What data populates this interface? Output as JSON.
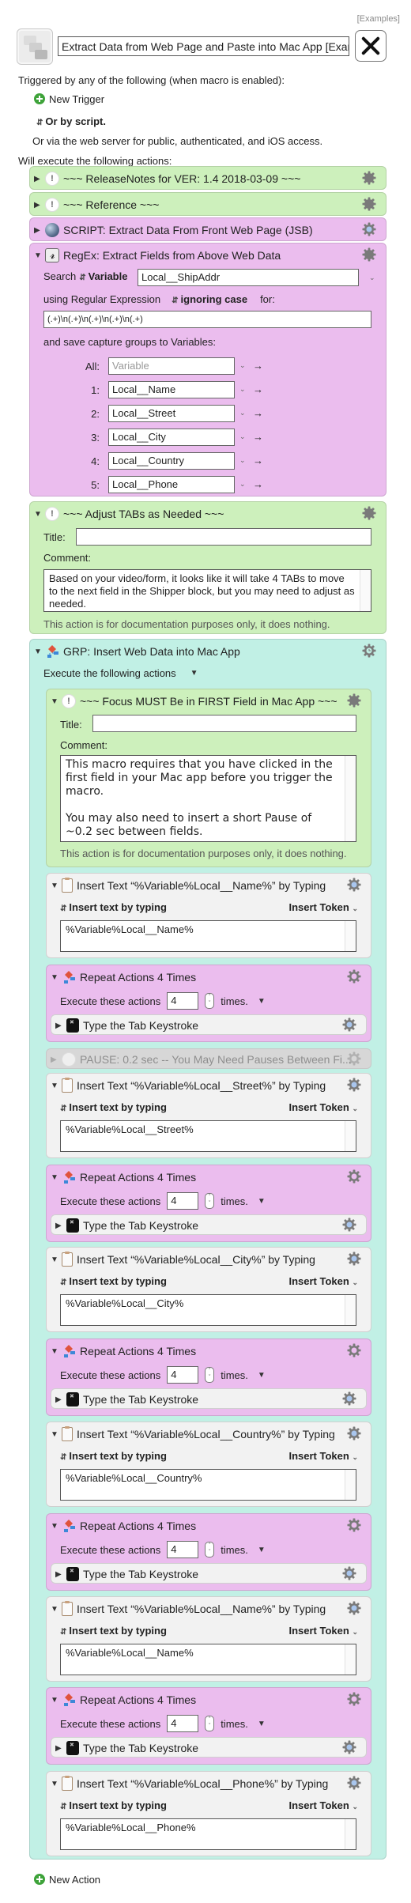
{
  "header": {
    "examples_link": "[Examples]",
    "macro_name": "Extract Data from Web Page and Paste into Mac App [Example]",
    "triggered_label": "Triggered by any of the following (when macro is enabled):",
    "new_trigger": "New Trigger",
    "or_by_script": "Or by script.",
    "web_server_text": "Or via the web server for public, authenticated, and iOS access.",
    "will_execute": "Will execute the following actions:"
  },
  "actions": {
    "release_notes": {
      "title": "~~~ ReleaseNotes for  VER: 1.4    2018-03-09 ~~~"
    },
    "reference": {
      "title": "~~~ Reference ~~~"
    },
    "script": {
      "title": "SCRIPT:  Extract Data From Front Web Page (JSB)"
    },
    "regex": {
      "title": "RegEx: Extract Fields from Above Web Data",
      "search_label": "Search",
      "source_mode": "Variable",
      "source_value": "Local__ShipAddr",
      "using_label": "using Regular Expression",
      "case_mode": "ignoring case",
      "for_label": "for:",
      "pattern": "(.+)\\n(.+)\\n(.+)\\n(.+)\\n(.+)",
      "save_label": "and save capture groups to Variables:",
      "groups": [
        {
          "label": "All:",
          "value": "",
          "placeholder": "Variable"
        },
        {
          "label": "1:",
          "value": "Local__Name"
        },
        {
          "label": "2:",
          "value": "Local__Street"
        },
        {
          "label": "3:",
          "value": "Local__City"
        },
        {
          "label": "4:",
          "value": "Local__Country"
        },
        {
          "label": "5:",
          "value": "Local__Phone"
        }
      ]
    },
    "adjust_tabs": {
      "title": "~~~ Adjust TABs as Needed ~~~",
      "title_label": "Title:",
      "title_value": "",
      "comment_label": "Comment:",
      "comment": "Based on your video/form, it looks like it will take 4 TABs to move to the next field in the Shipper block, but you may need to adjust as needed.",
      "doc_note": "This action is for documentation purposes only, it does nothing."
    },
    "group": {
      "title": "GRP: Insert Web Data into Mac App",
      "execute_label": "Execute the following actions",
      "focus_note": {
        "title": "~~~ Focus MUST Be in FIRST Field in Mac App ~~~",
        "title_label": "Title:",
        "title_value": "",
        "comment_label": "Comment:",
        "comment_line1": "This macro requires that you have clicked in the first field in your Mac app before you trigger the macro.",
        "comment_line2": "You may also need to insert a short Pause of ~0.2 sec between fields.",
        "doc_note": "This action is for documentation purposes only, it does nothing."
      },
      "insert_mode": "Insert text by typing",
      "insert_token": "Insert Token",
      "repeat_title": "Repeat Actions 4 Times",
      "repeat_execute": "Execute these actions",
      "repeat_count": "4",
      "repeat_times": "times.",
      "tab_keystroke": "Type the Tab Keystroke",
      "pause": "PAUSE:  0.2 sec  -- You May Need Pauses Between Fi...",
      "inserts": [
        {
          "title": "Insert Text “%Variable%Local__Name%” by Typing",
          "text": "%Variable%Local__Name%"
        },
        {
          "title": "Insert Text “%Variable%Local__Street%” by Typing",
          "text": "%Variable%Local__Street%"
        },
        {
          "title": "Insert Text “%Variable%Local__City%” by Typing",
          "text": "%Variable%Local__City%"
        },
        {
          "title": "Insert Text “%Variable%Local__Country%” by Typing",
          "text": "%Variable%Local__Country%"
        },
        {
          "title": "Insert Text “%Variable%Local__Name%” by Typing",
          "text": "%Variable%Local__Name%"
        },
        {
          "title": "Insert Text “%Variable%Local__Phone%” by Typing",
          "text": "%Variable%Local__Phone%"
        }
      ]
    }
  },
  "footer": {
    "new_action": "New Action"
  },
  "colors": {
    "comment_green": "#cdf0bc",
    "script_pink": "#ebbdee",
    "group_teal": "#c1f0e5",
    "plus_green": "#3ea33a"
  }
}
